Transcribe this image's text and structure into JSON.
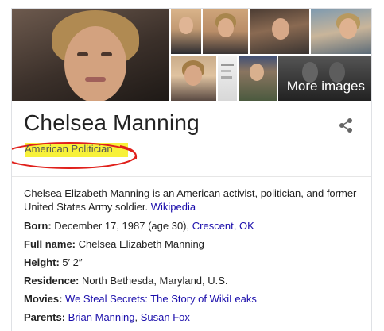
{
  "images": {
    "more_label": "More images"
  },
  "entity": {
    "name": "Chelsea Manning",
    "subtitle": "American Politician",
    "description": "Chelsea Elizabeth Manning is an American activist, politician, and former United States Army soldier.",
    "source_link": "Wikipedia"
  },
  "facts": {
    "born": {
      "label": "Born:",
      "text": "December 17, 1987 (age 30),",
      "link": "Crescent, OK"
    },
    "full_name": {
      "label": "Full name:",
      "text": "Chelsea Elizabeth Manning"
    },
    "height": {
      "label": "Height:",
      "text": "5′ 2″"
    },
    "residence": {
      "label": "Residence:",
      "text": "North Bethesda, Maryland, U.S."
    },
    "movies": {
      "label": "Movies:",
      "link": "We Steal Secrets: The Story of WikiLeaks"
    },
    "parents": {
      "label": "Parents:",
      "link1": "Brian Manning",
      "sep": ", ",
      "link2": "Susan Fox"
    }
  },
  "colors": {
    "link": "#1a0dab",
    "highlight": "#f7f13a",
    "annotation_circle": "#e0201b"
  },
  "icons": {
    "share": "share-icon"
  }
}
